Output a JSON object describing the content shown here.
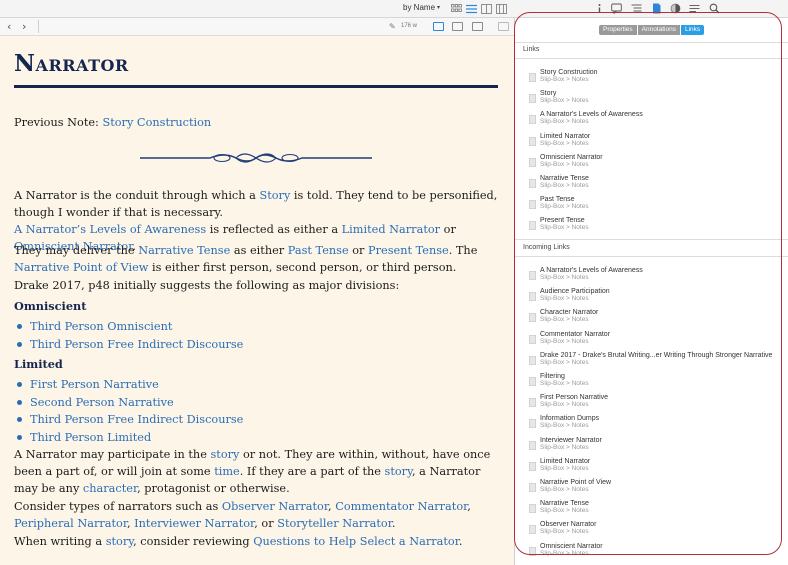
{
  "toolbar": {
    "sort_label": "by Name",
    "sort_caret": "▾"
  },
  "nav": {
    "back": "‹",
    "forward": "›",
    "word_count": "176 w",
    "word_count_icon": "✎"
  },
  "document": {
    "title": "Narrator",
    "previous_note_label": "Previous Note:",
    "previous_note_link": "Story Construction",
    "p1": {
      "a": "A Narrator is the conduit through which a ",
      "l1": "Story",
      "b": " is told. They tend to be personified, though I wonder if that is necessary."
    },
    "p2": {
      "l1": "A Narrator’s Levels of Awareness",
      "a": " is reflected as either a ",
      "l2": "Limited Narrator",
      "b": " or ",
      "l3": "Omniscient Narrator",
      "c": "."
    },
    "p3": {
      "a": "They may deliver the ",
      "l1": "Narrative Tense",
      "b": " as either ",
      "l2": "Past Tense",
      "c": " or ",
      "l3": "Present Tense",
      "d": ". The ",
      "l4": "Narrative Point of View",
      "e": " is either first person, second person, or third person."
    },
    "p4": "Drake 2017, p48 initially suggests the following as major divisions:",
    "h_omniscient": "Omniscient",
    "omniscient_list": [
      "Third Person Omniscient",
      "Third Person Free Indirect Discourse"
    ],
    "h_limited": "Limited",
    "limited_list": [
      "First Person Narrative",
      "Second Person Narrative",
      "Third Person Free Indirect Discourse",
      "Third Person Limited"
    ],
    "p5": {
      "a": "A Narrator may participate in the ",
      "l1": "story",
      "b": " or not. They are within, without, have once been a part of, or will join at some ",
      "l2": "time",
      "c": ". If they are a part of the ",
      "l3": "story",
      "d": ", a Narrator may be any ",
      "l4": "character",
      "e": ", protagonist or otherwise."
    },
    "p6": {
      "a": "Consider types of narrators such as ",
      "l1": "Observer Narrator",
      "b": ", ",
      "l2": "Commentator Narrator",
      "c": ", ",
      "l3": "Peripheral Narrator",
      "d": ", ",
      "l4": "Interviewer Narrator",
      "e": ", or ",
      "l5": "Storyteller Narrator",
      "f": "."
    },
    "p7": {
      "a": "When writing a ",
      "l1": "story",
      "b": ", consider reviewing ",
      "l2": "Questions to Help Select a Narrator",
      "c": "."
    }
  },
  "inspector": {
    "tabs": [
      "Properties",
      "Annotations",
      "Links"
    ],
    "active_tab": "Links",
    "links_header": "Links",
    "links": [
      {
        "title": "Story Construction",
        "path": "Slip-Box > Notes"
      },
      {
        "title": "Story",
        "path": "Slip-Box > Notes"
      },
      {
        "title": "A Narrator's Levels of Awareness",
        "path": "Slip-Box > Notes"
      },
      {
        "title": "Limited Narrator",
        "path": "Slip-Box > Notes"
      },
      {
        "title": "Omniscient Narrator",
        "path": "Slip-Box > Notes"
      },
      {
        "title": "Narrative Tense",
        "path": "Slip-Box > Notes"
      },
      {
        "title": "Past Tense",
        "path": "Slip-Box > Notes"
      },
      {
        "title": "Present Tense",
        "path": "Slip-Box > Notes"
      }
    ],
    "incoming_header": "Incoming Links",
    "incoming": [
      {
        "title": "A Narrator's Levels of Awareness",
        "path": "Slip-Box > Notes"
      },
      {
        "title": "Audience Participation",
        "path": "Slip-Box > Notes"
      },
      {
        "title": "Character Narrator",
        "path": "Slip-Box > Notes"
      },
      {
        "title": "Commentator Narrator",
        "path": "Slip-Box > Notes"
      },
      {
        "title": "Drake 2017 - Drake's Brutal Writing...er Writing Through Stronger Narrative",
        "path": "Slip-Box > Notes"
      },
      {
        "title": "Filtering",
        "path": "Slip-Box > Notes"
      },
      {
        "title": "First Person Narrative",
        "path": "Slip-Box > Notes"
      },
      {
        "title": "Information Dumps",
        "path": "Slip-Box > Notes"
      },
      {
        "title": "Interviewer Narrator",
        "path": "Slip-Box > Notes"
      },
      {
        "title": "Limited Narrator",
        "path": "Slip-Box > Notes"
      },
      {
        "title": "Narrative Point of View",
        "path": "Slip-Box > Notes"
      },
      {
        "title": "Narrative Tense",
        "path": "Slip-Box > Notes"
      },
      {
        "title": "Observer Narrator",
        "path": "Slip-Box > Notes"
      },
      {
        "title": "Omniscient Narrator",
        "path": "Slip-Box > Notes"
      }
    ]
  },
  "colors": {
    "link": "#2a6db5",
    "title": "#14264f",
    "active_tab": "#2c9ee6",
    "annotation": "#b3303a",
    "paper": "#fdf6e8"
  },
  "icons": [
    "grid-view-icon",
    "list-view-icon",
    "column-view-icon",
    "outline-view-icon",
    "info-icon",
    "comment-icon",
    "toc-icon",
    "bookmark-icon",
    "appearance-icon",
    "format-icon",
    "search-icon",
    "word-count-icon",
    "doc-icon"
  ]
}
